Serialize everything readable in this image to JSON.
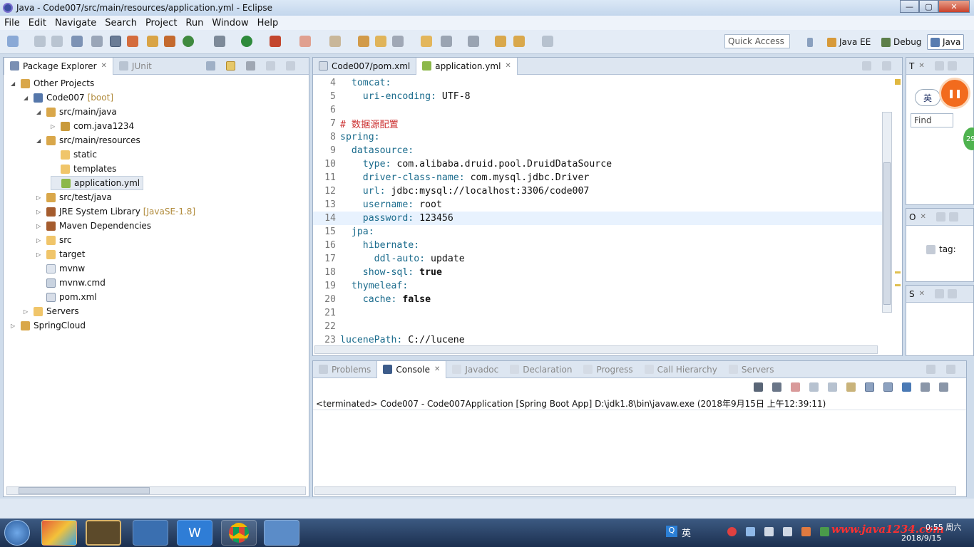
{
  "window": {
    "title": "Java - Code007/src/main/resources/application.yml - Eclipse",
    "minimize": "—",
    "maximize": "▢",
    "close": "✕"
  },
  "menu": [
    "File",
    "Edit",
    "Navigate",
    "Search",
    "Project",
    "Run",
    "Window",
    "Help"
  ],
  "toolbar": {
    "quick_access": "Quick Access",
    "perspectives": [
      "Java EE",
      "Debug",
      "Java"
    ]
  },
  "package_explorer": {
    "tabs": [
      "Package Explorer",
      "JUnit"
    ],
    "tree": [
      {
        "label": "Other Projects",
        "indent": 0,
        "arrow": "◢"
      },
      {
        "label": "Code007",
        "deco": "[boot]",
        "indent": 1,
        "arrow": "◢"
      },
      {
        "label": "src/main/java",
        "indent": 2,
        "arrow": "◢"
      },
      {
        "label": "com.java1234",
        "indent": 3,
        "arrow": "▷"
      },
      {
        "label": "src/main/resources",
        "indent": 2,
        "arrow": "◢"
      },
      {
        "label": "static",
        "indent": 3,
        "arrow": ""
      },
      {
        "label": "templates",
        "indent": 3,
        "arrow": ""
      },
      {
        "label": "application.yml",
        "indent": 3,
        "arrow": ""
      },
      {
        "label": "src/test/java",
        "indent": 2,
        "arrow": "▷"
      },
      {
        "label": "JRE System Library",
        "deco": "[JavaSE-1.8]",
        "indent": 2,
        "arrow": "▷"
      },
      {
        "label": "Maven Dependencies",
        "indent": 2,
        "arrow": "▷"
      },
      {
        "label": "src",
        "indent": 2,
        "arrow": "▷"
      },
      {
        "label": "target",
        "indent": 2,
        "arrow": "▷"
      },
      {
        "label": "mvnw",
        "indent": 2,
        "arrow": ""
      },
      {
        "label": "mvnw.cmd",
        "indent": 2,
        "arrow": ""
      },
      {
        "label": "pom.xml",
        "indent": 2,
        "arrow": ""
      },
      {
        "label": "Servers",
        "indent": 1,
        "arrow": "▷"
      },
      {
        "label": "SpringCloud",
        "indent": 0,
        "arrow": "▷"
      }
    ]
  },
  "editor": {
    "tabs": [
      "Code007/pom.xml",
      "application.yml"
    ],
    "lines": [
      {
        "n": "4",
        "text": "  tomcat:",
        "type": "key"
      },
      {
        "n": "5",
        "text": "    uri-encoding: UTF-8",
        "type": "kv",
        "k": "    uri-encoding:",
        "v": " UTF-8"
      },
      {
        "n": "6",
        "text": "",
        "type": "blank"
      },
      {
        "n": "7",
        "text": "# 数据源配置",
        "type": "cmt"
      },
      {
        "n": "8",
        "text": "spring:",
        "type": "key"
      },
      {
        "n": "9",
        "text": "  datasource:",
        "type": "key"
      },
      {
        "n": "10",
        "k": "    type:",
        "v": " com.alibaba.druid.pool.DruidDataSource",
        "type": "kv"
      },
      {
        "n": "11",
        "k": "    driver-class-name:",
        "v": " com.mysql.jdbc.Driver",
        "type": "kv"
      },
      {
        "n": "12",
        "k": "    url:",
        "v": " jdbc:mysql://localhost:3306/code007",
        "type": "kv"
      },
      {
        "n": "13",
        "k": "    username:",
        "v": " root",
        "type": "kv"
      },
      {
        "n": "14",
        "k": "    password:",
        "v": " 123456",
        "type": "kv",
        "hl": true
      },
      {
        "n": "15",
        "text": "  jpa:",
        "type": "key"
      },
      {
        "n": "16",
        "text": "    hibernate:",
        "type": "key"
      },
      {
        "n": "17",
        "k": "      ddl-auto:",
        "v": " update",
        "type": "kv"
      },
      {
        "n": "18",
        "k": "    show-sql:",
        "v": " true",
        "type": "kv",
        "bold": true
      },
      {
        "n": "19",
        "text": "  thymeleaf:",
        "type": "key"
      },
      {
        "n": "20",
        "k": "    cache:",
        "v": " false",
        "type": "kv",
        "bold": true
      },
      {
        "n": "21",
        "text": "",
        "type": "blank"
      },
      {
        "n": "22",
        "text": "",
        "type": "blank"
      },
      {
        "n": "23",
        "k": "lucenePath:",
        "v": " C://lucene",
        "type": "kv"
      }
    ]
  },
  "right_panes": {
    "outline_tab": "T",
    "find_label": "Find",
    "ime": "英",
    "pane2_tab": "O",
    "pane2_item": "tag:",
    "pane3_tab": "S",
    "badge": "29"
  },
  "console": {
    "tabs": [
      "Problems",
      "Console",
      "Javadoc",
      "Declaration",
      "Progress",
      "Call Hierarchy",
      "Servers"
    ],
    "header": "<terminated> Code007 - Code007Application [Spring Boot App] D:\\jdk1.8\\bin\\javaw.exe (2018年9月15日 上午12:39:11)"
  },
  "taskbar": {
    "tray_lang": "英",
    "time": "0:55 周六",
    "date": "2018/9/15",
    "watermark": "www.java1234.com"
  },
  "colors": {
    "key": "#1a6b8c",
    "comment": "#cc3333",
    "accent": "#3d6fb0"
  }
}
